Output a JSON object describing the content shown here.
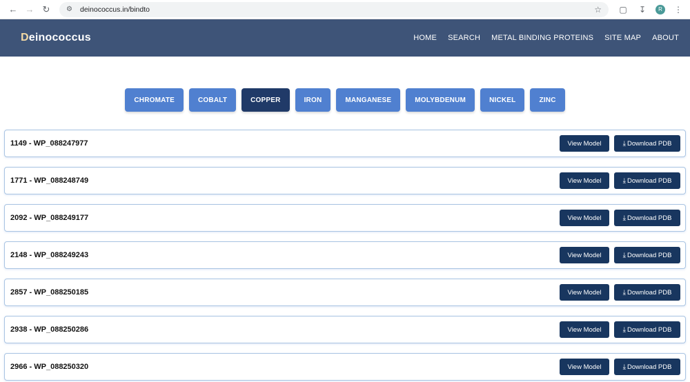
{
  "browser": {
    "url": "deinococcus.in/bindto",
    "profile_initial": "R"
  },
  "site": {
    "logo_first": "D",
    "logo_rest": "einococcus",
    "nav": [
      "HOME",
      "SEARCH",
      "METAL BINDING PROTEINS",
      "SITE MAP",
      "ABOUT"
    ]
  },
  "metals": {
    "items": [
      "CHROMATE",
      "COBALT",
      "COPPER",
      "IRON",
      "MANGANESE",
      "MOLYBDENUM",
      "NICKEL",
      "ZINC"
    ],
    "selected": "COPPER"
  },
  "actions": {
    "view_label": "View Model",
    "download_label": "Download PDB"
  },
  "proteins": [
    {
      "title": "1149 - WP_088247977"
    },
    {
      "title": "1771 - WP_088248749"
    },
    {
      "title": "2092 - WP_088249177"
    },
    {
      "title": "2148 - WP_088249243"
    },
    {
      "title": "2857 - WP_088250185"
    },
    {
      "title": "2938 - WP_088250286"
    },
    {
      "title": "2966 - WP_088250320"
    }
  ],
  "colors": {
    "header_bg": "#3e5478",
    "metal_button": "#5080d0",
    "metal_button_active": "#203a68",
    "action_button": "#18365f"
  }
}
